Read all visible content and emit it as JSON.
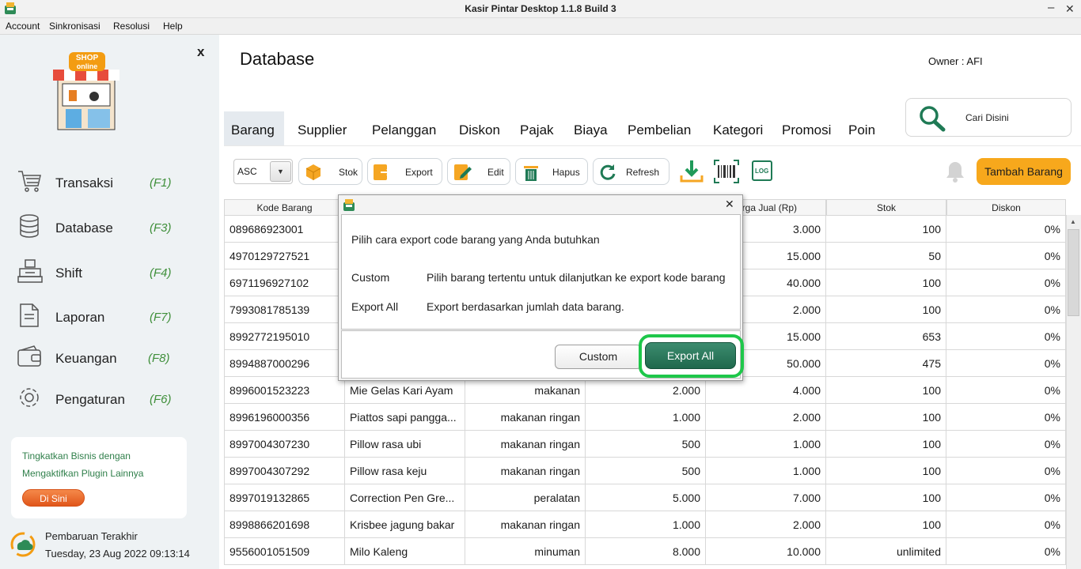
{
  "window": {
    "title": "Kasir Pintar Desktop 1.1.8  Build 3",
    "minimize": "–",
    "maximize": "□",
    "close": "✕"
  },
  "menu": [
    "Account",
    "Sinkronisasi",
    "Resolusi",
    "Help"
  ],
  "sidebar": {
    "close": "x",
    "logo_text_1": "SHOP",
    "logo_text_2": "online",
    "items": [
      {
        "label": "Transaksi",
        "key": "(F1)",
        "icon": "cart-icon"
      },
      {
        "label": "Database",
        "key": "(F3)",
        "icon": "database-icon"
      },
      {
        "label": "Shift",
        "key": "(F4)",
        "icon": "cash-register-icon"
      },
      {
        "label": "Laporan",
        "key": "(F7)",
        "icon": "document-icon"
      },
      {
        "label": "Keuangan",
        "key": "(F8)",
        "icon": "wallet-icon"
      },
      {
        "label": "Pengaturan",
        "key": "(F6)",
        "icon": "gear-icon"
      }
    ],
    "promo": {
      "line1": "Tingkatkan Bisnis dengan",
      "line2": "Mengaktifkan Plugin Lainnya",
      "button": "Di Sini"
    },
    "update": {
      "label": "Pembaruan Terakhir",
      "datetime": "Tuesday, 23 Aug 2022 09:13:14"
    }
  },
  "main": {
    "title": "Database",
    "owner": "Owner : AFI",
    "search": "Cari Disini",
    "tabs": [
      "Barang",
      "Supplier",
      "Pelanggan",
      "Diskon",
      "Pajak",
      "Biaya",
      "Pembelian",
      "Kategori",
      "Promosi",
      "Poin"
    ],
    "active_tab": "Barang",
    "toolbar": {
      "sort": "ASC",
      "stok": "Stok",
      "export": "Export",
      "edit": "Edit",
      "hapus": "Hapus",
      "refresh": "Refresh",
      "log": "LOG",
      "tambah": "Tambah Barang"
    },
    "table": {
      "headers": [
        "Kode Barang",
        "",
        "",
        "",
        "Harga Jual (Rp)",
        "Stok",
        "Diskon"
      ],
      "header_visible_5": "arga Jual (Rp)",
      "rows": [
        [
          "089686923001",
          "",
          "",
          "",
          "3.000",
          "100",
          "0%"
        ],
        [
          "4970129727521",
          "",
          "",
          "",
          "15.000",
          "50",
          "0%"
        ],
        [
          "6971196927102",
          "",
          "",
          "",
          "40.000",
          "100",
          "0%"
        ],
        [
          "7993081785139",
          "",
          "",
          "",
          "2.000",
          "100",
          "0%"
        ],
        [
          "8992772195010",
          "",
          "",
          "",
          "15.000",
          "653",
          "0%"
        ],
        [
          "8994887000296",
          "",
          "",
          "",
          "50.000",
          "475",
          "0%"
        ],
        [
          "8996001523223",
          "Mie Gelas Kari Ayam",
          "makanan",
          "2.000",
          "4.000",
          "100",
          "0%"
        ],
        [
          "8996196000356",
          "Piattos sapi pangga...",
          "makanan ringan",
          "1.000",
          "2.000",
          "100",
          "0%"
        ],
        [
          "8997004307230",
          "Pillow rasa ubi",
          "makanan ringan",
          "500",
          "1.000",
          "100",
          "0%"
        ],
        [
          "8997004307292",
          "Pillow rasa keju",
          "makanan ringan",
          "500",
          "1.000",
          "100",
          "0%"
        ],
        [
          "8997019132865",
          "Correction Pen Gre...",
          "peralatan",
          "5.000",
          "7.000",
          "100",
          "0%"
        ],
        [
          "8998866201698",
          "Krisbee jagung bakar",
          "makanan ringan",
          "1.000",
          "2.000",
          "100",
          "0%"
        ],
        [
          "9556001051509",
          "Milo Kaleng",
          "minuman",
          "8.000",
          "10.000",
          "unlimited",
          "0%"
        ]
      ]
    }
  },
  "dialog": {
    "close": "✕",
    "message": "Pilih cara export code barang yang Anda butuhkan",
    "options": [
      {
        "name": "Custom",
        "desc": "Pilih barang tertentu untuk dilanjutkan ke export kode barang"
      },
      {
        "name": "Export All",
        "desc": "Export berdasarkan jumlah data barang."
      }
    ],
    "btn_custom": "Custom",
    "btn_export": "Export All"
  },
  "colors": {
    "accent": "#f7a81c",
    "green": "#1f684c",
    "highlight": "#1ec74a",
    "sidebar": "#eef2f4"
  }
}
